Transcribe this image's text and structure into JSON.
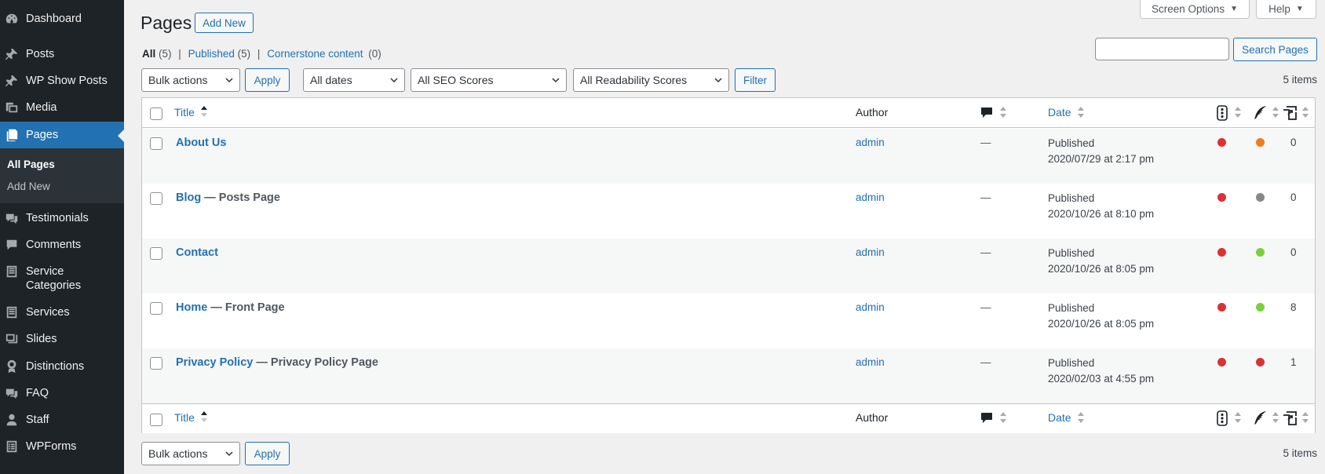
{
  "sidebar": {
    "items": [
      {
        "label": "Dashboard",
        "icon": "dashboard-icon"
      },
      {
        "label": "Posts",
        "icon": "pin-icon"
      },
      {
        "label": "WP Show Posts",
        "icon": "pin-icon"
      },
      {
        "label": "Media",
        "icon": "media-icon"
      },
      {
        "label": "Pages",
        "icon": "pages-icon"
      },
      {
        "label": "Testimonials",
        "icon": "testimonial-icon"
      },
      {
        "label": "Comments",
        "icon": "comment-icon"
      },
      {
        "label": "Service Categories",
        "icon": "list-icon"
      },
      {
        "label": "Services",
        "icon": "list-icon"
      },
      {
        "label": "Slides",
        "icon": "slides-icon"
      },
      {
        "label": "Distinctions",
        "icon": "award-icon"
      },
      {
        "label": "FAQ",
        "icon": "faq-icon"
      },
      {
        "label": "Staff",
        "icon": "user-icon"
      },
      {
        "label": "WPForms",
        "icon": "forms-icon"
      }
    ],
    "submenu": [
      {
        "label": "All Pages"
      },
      {
        "label": "Add New"
      }
    ]
  },
  "header": {
    "title": "Pages",
    "add_new": "Add New",
    "screen_options": "Screen Options",
    "help": "Help"
  },
  "filters_nav": {
    "all_label": "All",
    "all_count": "(5)",
    "published_label": "Published",
    "published_count": "(5)",
    "cornerstone_label": "Cornerstone content",
    "cornerstone_count": "(0)",
    "separator": "|"
  },
  "search": {
    "value": "",
    "button": "Search Pages"
  },
  "tablenav": {
    "bulk_actions": "Bulk actions",
    "apply": "Apply",
    "dates": "All dates",
    "seo": "All SEO Scores",
    "readability": "All Readability Scores",
    "filter": "Filter",
    "items_count": "5 items"
  },
  "table": {
    "columns": {
      "title": "Title",
      "author": "Author",
      "date": "Date"
    },
    "rows": [
      {
        "title": "About Us",
        "state": "",
        "author": "admin",
        "comments": "—",
        "status": "Published",
        "date": "2020/07/29 at 2:17 pm",
        "seo_color": "#dc3232",
        "read_color": "#ee7c1b",
        "links": "0"
      },
      {
        "title": "Blog",
        "state": "— Posts Page",
        "author": "admin",
        "comments": "—",
        "status": "Published",
        "date": "2020/10/26 at 8:10 pm",
        "seo_color": "#dc3232",
        "read_color": "#888888",
        "links": "0"
      },
      {
        "title": "Contact",
        "state": "",
        "author": "admin",
        "comments": "—",
        "status": "Published",
        "date": "2020/10/26 at 8:05 pm",
        "seo_color": "#dc3232",
        "read_color": "#7ad03a",
        "links": "0"
      },
      {
        "title": "Home",
        "state": "— Front Page",
        "author": "admin",
        "comments": "—",
        "status": "Published",
        "date": "2020/10/26 at 8:05 pm",
        "seo_color": "#dc3232",
        "read_color": "#7ad03a",
        "links": "8"
      },
      {
        "title": "Privacy Policy",
        "state": "— Privacy Policy Page",
        "author": "admin",
        "comments": "—",
        "status": "Published",
        "date": "2020/02/03 at 4:55 pm",
        "seo_color": "#dc3232",
        "read_color": "#dc3232",
        "links": "1"
      }
    ]
  },
  "colors": {
    "accent": "#2271b1",
    "sidebar_bg": "#1d2327",
    "page_bg": "#f0f0f1"
  }
}
